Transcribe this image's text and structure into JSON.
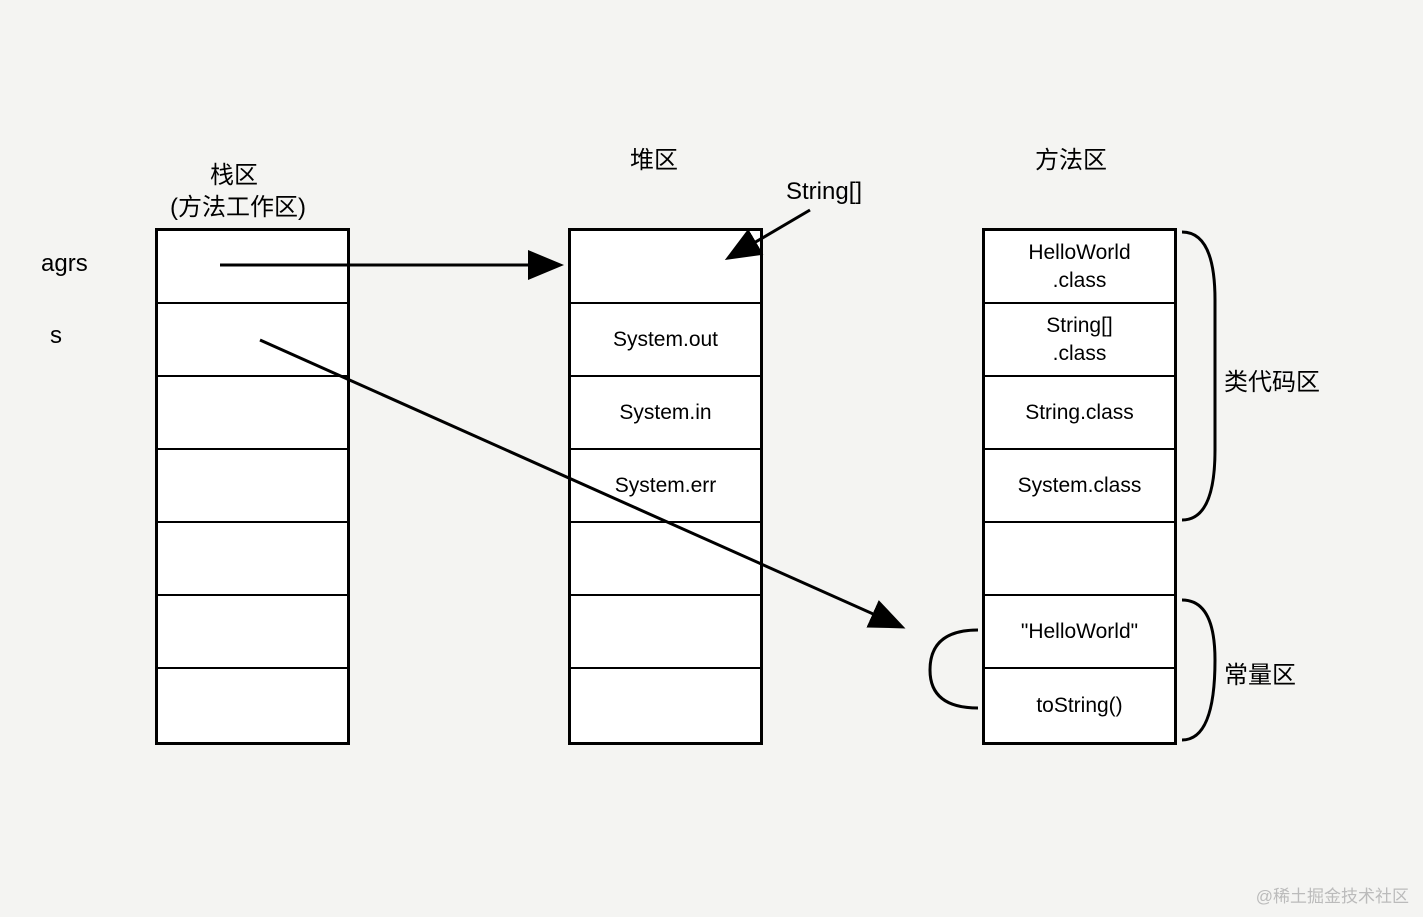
{
  "titles": {
    "stack_line1": "栈区",
    "stack_line2": "(方法工作区)",
    "heap": "堆区",
    "method": "方法区"
  },
  "stack_labels": {
    "agrs": "agrs",
    "s": "s"
  },
  "heap_cells": {
    "c0": "",
    "c1": "System.out",
    "c2": "System.in",
    "c3": "System.err",
    "c4": "",
    "c5": "",
    "c6": ""
  },
  "heap_annotation": "String[]",
  "method_cells": {
    "c0_l1": "HelloWorld",
    "c0_l2": ".class",
    "c1_l1": "String[]",
    "c1_l2": ".class",
    "c2": "String.class",
    "c3": "System.class",
    "c4": "",
    "c5": "\"HelloWorld\"",
    "c6": "toString()"
  },
  "region_labels": {
    "class_code": "类代码区",
    "constant": "常量区"
  },
  "watermark": "@稀土掘金技术社区"
}
